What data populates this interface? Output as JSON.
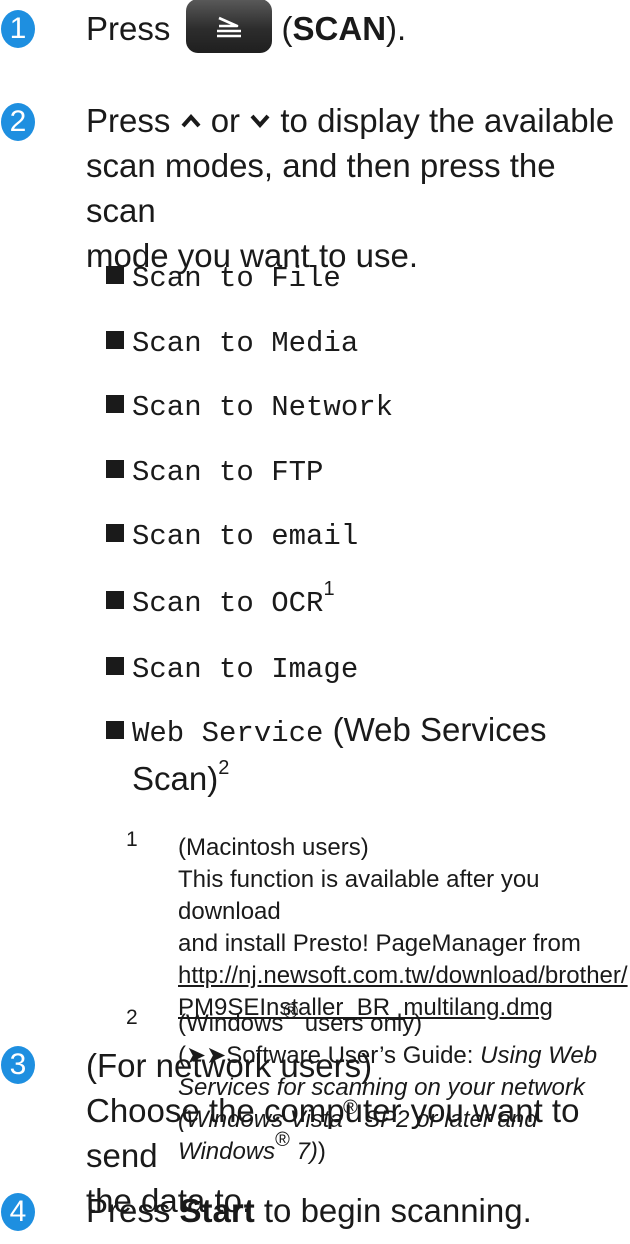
{
  "steps": [
    {
      "num": "1",
      "press": "Press",
      "open": "(",
      "scan_label": "SCAN",
      "close": ")."
    },
    {
      "num": "2",
      "line1_a": "Press",
      "or": "or",
      "line1_b": "to display the available",
      "line2": "scan modes, and then press the scan",
      "line3": "mode you want to use."
    },
    {
      "num": "3",
      "line1": "(For network users)",
      "line2": "Choose the computer you want to send",
      "line3": "the data to."
    },
    {
      "num": "4",
      "press": "Press",
      "start_label": "Start",
      "rest": "to begin scanning."
    }
  ],
  "scan_modes": [
    {
      "label": "Scan to File"
    },
    {
      "label": "Scan to Media"
    },
    {
      "label": "Scan to Network"
    },
    {
      "label": "Scan to FTP"
    },
    {
      "label": "Scan to email"
    },
    {
      "label": "Scan to OCR",
      "footnote_ref": "1"
    },
    {
      "label": "Scan to Image"
    },
    {
      "label": "Web Service",
      "suffix_a": "(Web Services",
      "suffix_b": "Scan)",
      "footnote_ref": "2"
    }
  ],
  "footnotes": [
    {
      "num": "1",
      "line1": "(Macintosh users)",
      "line2": "This function is available after you download",
      "line3": "and install Presto! PageManager from",
      "link_line1": "http://nj.newsoft.com.tw/download/brother/",
      "link_line2": "PM9SEInstaller_BR_multilang.dmg"
    },
    {
      "num": "2",
      "line1_a": "(Windows",
      "reg": "®",
      "line1_b": "users only)",
      "line2_a": "(",
      "arrows": "➤➤",
      "line2_b": "Software User’s Guide:",
      "line2_i": "Using Web",
      "line3_i": "Services for scanning on your network",
      "line4_i_a": "(Windows Vista",
      "line4_i_b": "SP2 or later and",
      "line5_i_a": "Windows",
      "line5_i_b": "7)",
      "line5_close": ")"
    }
  ],
  "icons": {
    "scan": "scan-icon",
    "up": "chevron-up-icon",
    "down": "chevron-down-icon"
  },
  "colors": {
    "step_badge": "#1e8fe0"
  }
}
